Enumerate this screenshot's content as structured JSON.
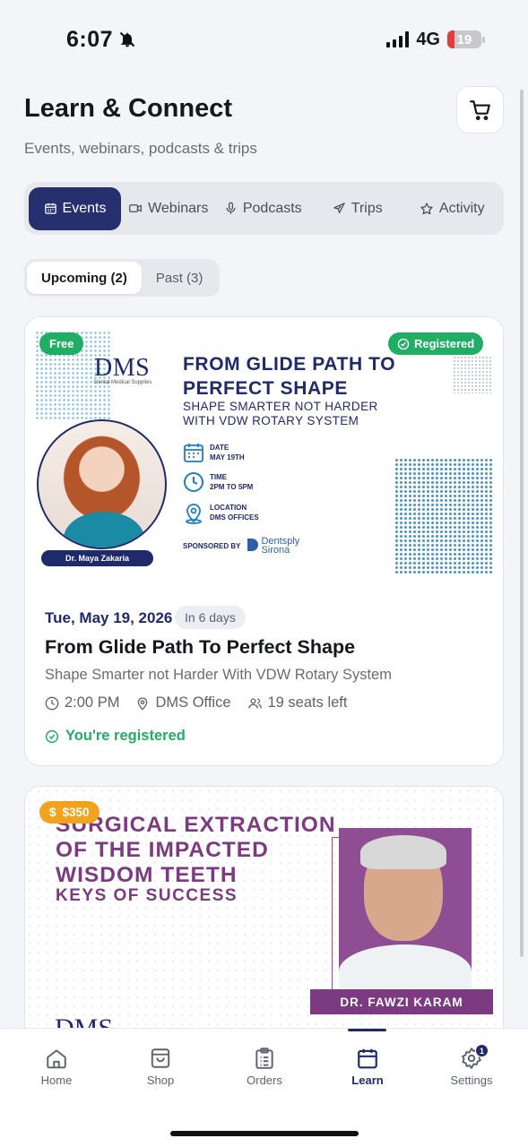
{
  "status_bar": {
    "time": "6:07",
    "network": "4G",
    "battery": "19"
  },
  "header": {
    "title": "Learn & Connect",
    "subtitle": "Events, webinars, podcasts & trips",
    "cart_icon": "cart-icon"
  },
  "tabs": [
    {
      "label": "Events",
      "icon": "calendar-icon",
      "active": true
    },
    {
      "label": "Webinars",
      "icon": "video-icon",
      "active": false
    },
    {
      "label": "Podcasts",
      "icon": "microphone-icon",
      "active": false
    },
    {
      "label": "Trips",
      "icon": "plane-icon",
      "active": false
    },
    {
      "label": "Activity",
      "icon": "star-icon",
      "active": false
    }
  ],
  "filter": {
    "upcoming": "Upcoming (2)",
    "past": "Past (3)",
    "selected": "upcoming"
  },
  "events": [
    {
      "price_badge": "Free",
      "status_badge": "Registered",
      "banner": {
        "logo": "DMS",
        "logo_tagline": "Dental Medical Supplies",
        "title_line1": "FROM GLIDE PATH TO",
        "title_line2": "PERFECT SHAPE",
        "subtitle_line1": "SHAPE SMARTER NOT HARDER",
        "subtitle_line2": "WITH VDW ROTARY SYSTEM",
        "date_label": "DATE",
        "date_value": "MAY 19TH",
        "time_label": "TIME",
        "time_value": "2PM TO 5PM",
        "location_label": "LOCATION",
        "location_value": "DMS OFFICES",
        "sponsored_by": "SPONSORED BY",
        "sponsor_line1": "Dentsply",
        "sponsor_line2": "Sirona",
        "speaker": "Dr. Maya Zakaria"
      },
      "date": "Tue, May 19, 2026",
      "countdown": "In 6 days",
      "title": "From Glide Path To Perfect Shape",
      "subtitle": "Shape Smarter not Harder With VDW Rotary System",
      "time": "2:00 PM",
      "location": "DMS Office",
      "seats": "19 seats left",
      "registration_status": "You're registered"
    },
    {
      "price_badge": "$350",
      "banner": {
        "title_line1": "SURGICAL EXTRACTION",
        "title_line2": "OF THE IMPACTED",
        "title_line3": "WISDOM TEETH",
        "subtitle": "KEYS OF SUCCESS",
        "speaker": "DR. FAWZI KARAM",
        "logo": "DMS"
      }
    }
  ],
  "bottom_nav": [
    {
      "label": "Home",
      "icon": "home-icon",
      "active": false
    },
    {
      "label": "Shop",
      "icon": "shopping-bag-icon",
      "active": false
    },
    {
      "label": "Orders",
      "icon": "clipboard-icon",
      "active": false
    },
    {
      "label": "Learn",
      "icon": "calendar-icon",
      "active": true
    },
    {
      "label": "Settings",
      "icon": "gear-icon",
      "active": false,
      "badge": "1"
    }
  ],
  "colors": {
    "primary": "#27306e",
    "success": "#1fae63",
    "warning": "#f3a31b",
    "event2_accent": "#7c3a80",
    "background": "#f4f5f8"
  }
}
